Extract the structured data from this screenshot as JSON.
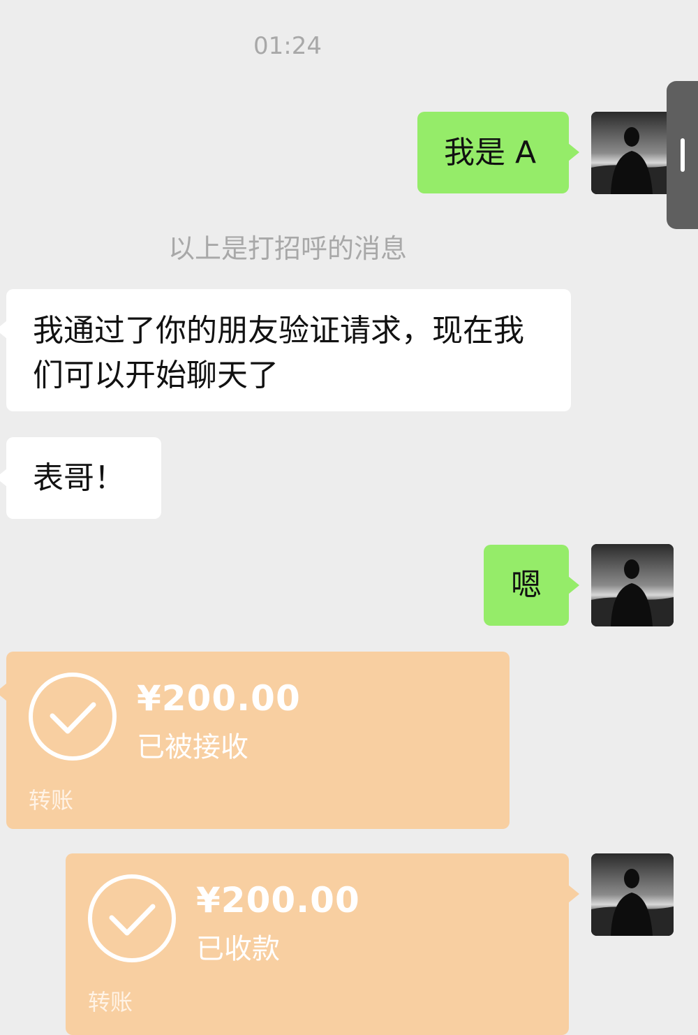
{
  "chat": {
    "timestamp": "01:24",
    "greeting_note": "以上是打招呼的消息",
    "messages": [
      {
        "side": "right",
        "text": "我是 A"
      },
      {
        "side": "left",
        "text": "我通过了你的朋友验证请求，现在我们可以开始聊天了"
      },
      {
        "side": "left",
        "text": "表哥！"
      },
      {
        "side": "right",
        "text": "嗯"
      }
    ],
    "transfers": [
      {
        "side": "left",
        "amount": "¥200.00",
        "status": "已被接收",
        "label": "转账"
      },
      {
        "side": "right",
        "amount": "¥200.00",
        "status": "已收款",
        "label": "转账"
      }
    ]
  },
  "colors": {
    "background": "#ededed",
    "sent_bubble": "#95ec69",
    "received_bubble": "#ffffff",
    "transfer_card": "#f8cfa1",
    "system_text": "#a8a8a8"
  },
  "icons": [
    "avatar-photo",
    "check-circle-icon",
    "scroll-handle-icon"
  ]
}
